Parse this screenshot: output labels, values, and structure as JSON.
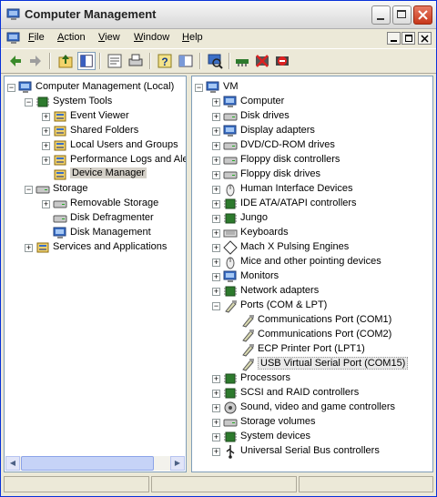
{
  "window": {
    "title": "Computer Management"
  },
  "menu": {
    "items": [
      "File",
      "Action",
      "View",
      "Window",
      "Help"
    ],
    "accel": [
      "F",
      "A",
      "V",
      "W",
      "H"
    ]
  },
  "left_tree": [
    {
      "label": "Computer Management (Local)",
      "icon": "computer-management-icon",
      "depth": 0,
      "expander": "minus"
    },
    {
      "label": "System Tools",
      "icon": "system-tools-icon",
      "depth": 1,
      "expander": "minus"
    },
    {
      "label": "Event Viewer",
      "icon": "event-viewer-icon",
      "depth": 2,
      "expander": "plus"
    },
    {
      "label": "Shared Folders",
      "icon": "shared-folders-icon",
      "depth": 2,
      "expander": "plus"
    },
    {
      "label": "Local Users and Groups",
      "icon": "users-icon",
      "depth": 2,
      "expander": "plus"
    },
    {
      "label": "Performance Logs and Alerts",
      "icon": "performance-icon",
      "depth": 2,
      "expander": "plus"
    },
    {
      "label": "Device Manager",
      "icon": "device-manager-icon",
      "depth": 2,
      "expander": "none",
      "selected": true
    },
    {
      "label": "Storage",
      "icon": "storage-icon",
      "depth": 1,
      "expander": "minus"
    },
    {
      "label": "Removable Storage",
      "icon": "removable-storage-icon",
      "depth": 2,
      "expander": "plus"
    },
    {
      "label": "Disk Defragmenter",
      "icon": "defrag-icon",
      "depth": 2,
      "expander": "none"
    },
    {
      "label": "Disk Management",
      "icon": "disk-management-icon",
      "depth": 2,
      "expander": "none"
    },
    {
      "label": "Services and Applications",
      "icon": "services-icon",
      "depth": 1,
      "expander": "plus"
    }
  ],
  "right_tree": [
    {
      "label": "VM",
      "icon": "computer-icon",
      "depth": 0,
      "expander": "minus"
    },
    {
      "label": "Computer",
      "icon": "computer-icon",
      "depth": 1,
      "expander": "plus"
    },
    {
      "label": "Disk drives",
      "icon": "disk-drive-icon",
      "depth": 1,
      "expander": "plus"
    },
    {
      "label": "Display adapters",
      "icon": "display-adapter-icon",
      "depth": 1,
      "expander": "plus"
    },
    {
      "label": "DVD/CD-ROM drives",
      "icon": "cdrom-icon",
      "depth": 1,
      "expander": "plus"
    },
    {
      "label": "Floppy disk controllers",
      "icon": "floppy-controller-icon",
      "depth": 1,
      "expander": "plus"
    },
    {
      "label": "Floppy disk drives",
      "icon": "floppy-icon",
      "depth": 1,
      "expander": "plus"
    },
    {
      "label": "Human Interface Devices",
      "icon": "hid-icon",
      "depth": 1,
      "expander": "plus"
    },
    {
      "label": "IDE ATA/ATAPI controllers",
      "icon": "ide-icon",
      "depth": 1,
      "expander": "plus"
    },
    {
      "label": "Jungo",
      "icon": "chip-icon",
      "depth": 1,
      "expander": "plus"
    },
    {
      "label": "Keyboards",
      "icon": "keyboard-icon",
      "depth": 1,
      "expander": "plus"
    },
    {
      "label": "Mach  X Pulsing Engines",
      "icon": "diamond-icon",
      "depth": 1,
      "expander": "plus"
    },
    {
      "label": "Mice and other pointing devices",
      "icon": "mouse-icon",
      "depth": 1,
      "expander": "plus"
    },
    {
      "label": "Monitors",
      "icon": "monitor-icon",
      "depth": 1,
      "expander": "plus"
    },
    {
      "label": "Network adapters",
      "icon": "network-icon",
      "depth": 1,
      "expander": "plus"
    },
    {
      "label": "Ports (COM & LPT)",
      "icon": "port-icon",
      "depth": 1,
      "expander": "minus"
    },
    {
      "label": "Communications Port (COM1)",
      "icon": "port-icon",
      "depth": 2,
      "expander": "none"
    },
    {
      "label": "Communications Port (COM2)",
      "icon": "port-icon",
      "depth": 2,
      "expander": "none"
    },
    {
      "label": "ECP Printer Port (LPT1)",
      "icon": "port-icon",
      "depth": 2,
      "expander": "none"
    },
    {
      "label": "USB Virtual Serial Port (COM15)",
      "icon": "port-icon",
      "depth": 2,
      "expander": "none",
      "selected": true
    },
    {
      "label": "Processors",
      "icon": "processor-icon",
      "depth": 1,
      "expander": "plus"
    },
    {
      "label": "SCSI and RAID controllers",
      "icon": "scsi-icon",
      "depth": 1,
      "expander": "plus"
    },
    {
      "label": "Sound, video and game controllers",
      "icon": "sound-icon",
      "depth": 1,
      "expander": "plus"
    },
    {
      "label": "Storage volumes",
      "icon": "storage-volume-icon",
      "depth": 1,
      "expander": "plus"
    },
    {
      "label": "System devices",
      "icon": "system-devices-icon",
      "depth": 1,
      "expander": "plus"
    },
    {
      "label": "Universal Serial Bus controllers",
      "icon": "usb-icon",
      "depth": 1,
      "expander": "plus"
    }
  ],
  "colors": {
    "title_bar": "#e4e4e4",
    "pane_border": "#7f9db9",
    "window_bg": "#ece9d8"
  }
}
